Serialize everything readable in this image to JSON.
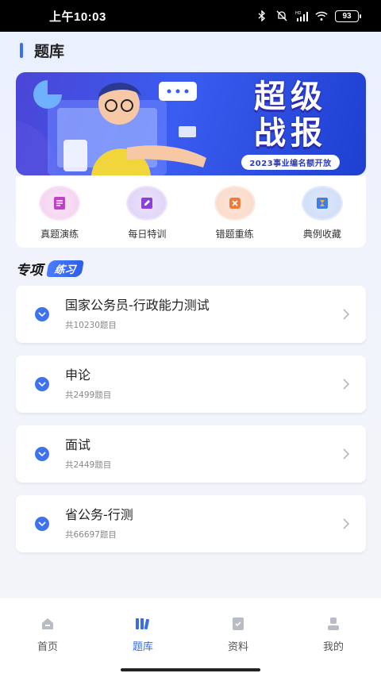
{
  "status_bar": {
    "time": "上午10:03",
    "battery": "93",
    "signal_label": "HD"
  },
  "header": {
    "title": "题库"
  },
  "banner": {
    "line1": "超级",
    "line2": "战报",
    "subtitle": "2023事业编名额开放"
  },
  "quick_menu": {
    "items": [
      {
        "label": "真题演练",
        "icon": "exam-paper-icon",
        "color": "#c13fc9"
      },
      {
        "label": "每日特训",
        "icon": "daily-edit-icon",
        "color": "#8a3fd8"
      },
      {
        "label": "错题重练",
        "icon": "error-box-icon",
        "color": "#f07a3a"
      },
      {
        "label": "典例收藏",
        "icon": "hourglass-bookmark-icon",
        "color": "#3f7ee8"
      }
    ]
  },
  "section": {
    "title": "专项",
    "badge": "练习"
  },
  "courses": [
    {
      "title": "国家公务员-行政能力测试",
      "count": "共10230题目"
    },
    {
      "title": "申论",
      "count": "共2499题目"
    },
    {
      "title": "面试",
      "count": "共2449题目"
    },
    {
      "title": "省公务-行测",
      "count": "共66697题目"
    }
  ],
  "bottom_nav": {
    "items": [
      {
        "label": "首页",
        "icon": "home-icon",
        "active": false
      },
      {
        "label": "题库",
        "icon": "books-icon",
        "active": true
      },
      {
        "label": "资料",
        "icon": "document-icon",
        "active": false
      },
      {
        "label": "我的",
        "icon": "profile-icon",
        "active": false
      }
    ]
  },
  "colors": {
    "accent": "#3a6ce8",
    "banner": "#3a5cf0"
  }
}
